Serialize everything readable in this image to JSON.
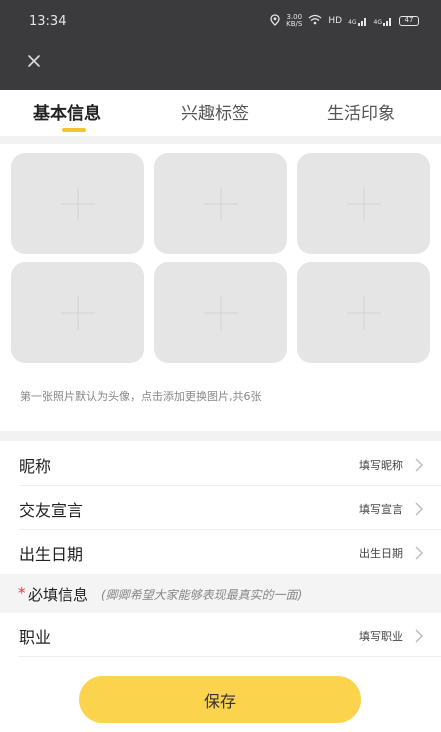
{
  "status_bar": {
    "time": "13:34",
    "speed_value": "3.00",
    "speed_unit": "KB/S",
    "hd": "HD",
    "signal_1": "4G",
    "signal_2": "4G",
    "battery": "47"
  },
  "tabs": [
    {
      "label": "基本信息",
      "active": true
    },
    {
      "label": "兴趣标签",
      "active": false
    },
    {
      "label": "生活印象",
      "active": false
    }
  ],
  "photos": {
    "slot_count": 6,
    "hint": "第一张照片默认为头像，点击添加更换图片,共6张"
  },
  "fields": {
    "nickname": {
      "label": "昵称",
      "placeholder": "填写昵称"
    },
    "motto": {
      "label": "交友宣言",
      "placeholder": "填写宣言"
    },
    "birthday": {
      "label": "出生日期",
      "placeholder": "出生日期"
    },
    "job": {
      "label": "职业",
      "placeholder": "填写职业"
    }
  },
  "required_section": {
    "star": "*",
    "title": "必填信息",
    "note": "(卿卿希望大家能够表现最真实的一面)"
  },
  "save_button": {
    "label": "保存"
  },
  "colors": {
    "accent": "#f4c430",
    "save_button": "#fbd34d",
    "top_bar": "#3b3b3e",
    "required_star": "#e23b3b"
  },
  "icons": {
    "close": "close-icon",
    "chevron": "chevron-right-icon",
    "add_photo": "plus-icon"
  }
}
